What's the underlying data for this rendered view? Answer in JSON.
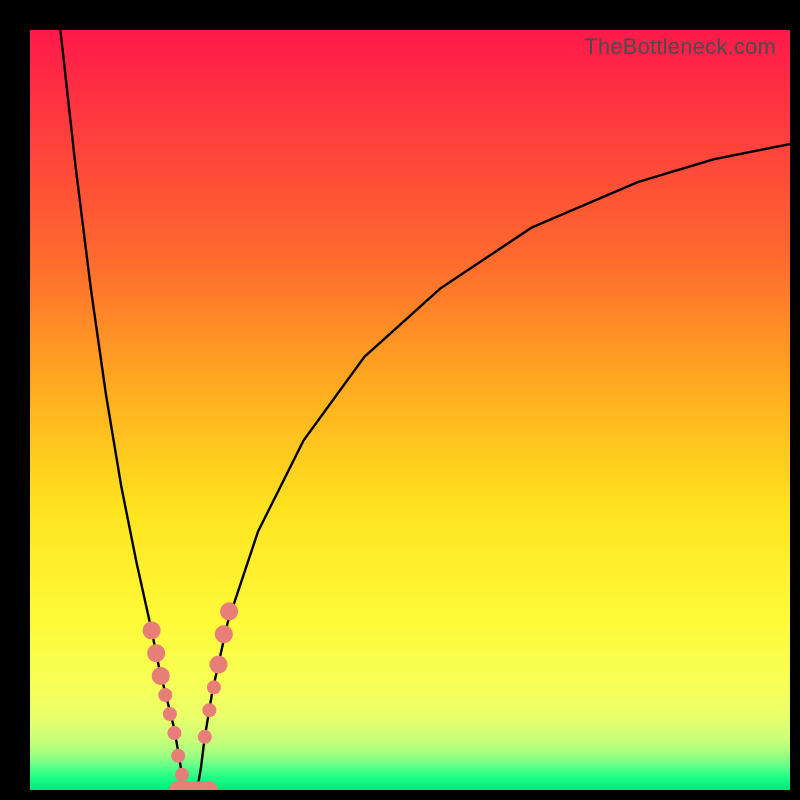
{
  "watermark": "TheBottleneck.com",
  "chart_data": {
    "type": "line",
    "title": "",
    "xlabel": "",
    "ylabel": "",
    "xlim": [
      0,
      100
    ],
    "ylim": [
      0,
      100
    ],
    "grid": false,
    "description": "Bottleneck-style V-curve over a vertical red→yellow→green gradient. Two black curves descend steeply from the top and meet near the bottom-left forming a V; the right branch then rises logarithmically toward the upper-right. Salmon dots cluster along the lower portions of both branches near the trough.",
    "gradient_stops": [
      {
        "offset": 0.0,
        "color": "#ff1a4b"
      },
      {
        "offset": 0.12,
        "color": "#ff3a3f"
      },
      {
        "offset": 0.3,
        "color": "#ff6a2f"
      },
      {
        "offset": 0.48,
        "color": "#ffb01f"
      },
      {
        "offset": 0.63,
        "color": "#ffe320"
      },
      {
        "offset": 0.78,
        "color": "#fffb3a"
      },
      {
        "offset": 0.86,
        "color": "#f7ff57"
      },
      {
        "offset": 0.905,
        "color": "#eaff6c"
      },
      {
        "offset": 0.935,
        "color": "#c9ff7a"
      },
      {
        "offset": 0.955,
        "color": "#9bff82"
      },
      {
        "offset": 0.97,
        "color": "#5cff88"
      },
      {
        "offset": 0.985,
        "color": "#1aff86"
      },
      {
        "offset": 1.0,
        "color": "#00e67a"
      }
    ],
    "series": [
      {
        "name": "left-branch",
        "x": [
          4,
          6,
          8,
          10,
          12,
          14,
          16,
          17,
          18,
          19,
          19.5,
          20,
          20.5
        ],
        "values": [
          100,
          82,
          66,
          52,
          40,
          30,
          21,
          16,
          12,
          8,
          5,
          2,
          0
        ]
      },
      {
        "name": "right-branch",
        "x": [
          22,
          22.5,
          23,
          24,
          26,
          30,
          36,
          44,
          54,
          66,
          80,
          90,
          100
        ],
        "values": [
          0,
          3,
          7,
          13,
          22,
          34,
          46,
          57,
          66,
          74,
          80,
          83,
          85
        ]
      }
    ],
    "trough_fill_x": [
      20.5,
      22
    ],
    "markers": {
      "color": "#e77f78",
      "radius_primary": 9,
      "radius_secondary": 7,
      "points": [
        {
          "x": 16.0,
          "y": 21.0,
          "r": 9
        },
        {
          "x": 16.6,
          "y": 18.0,
          "r": 9
        },
        {
          "x": 17.2,
          "y": 15.0,
          "r": 9
        },
        {
          "x": 17.8,
          "y": 12.5,
          "r": 7
        },
        {
          "x": 18.4,
          "y": 10.0,
          "r": 7
        },
        {
          "x": 19.0,
          "y": 7.5,
          "r": 7
        },
        {
          "x": 19.5,
          "y": 4.5,
          "r": 7
        },
        {
          "x": 20.0,
          "y": 2.0,
          "r": 7
        },
        {
          "x": 19.5,
          "y": 0.0,
          "r": 9
        },
        {
          "x": 20.5,
          "y": 0.0,
          "r": 9
        },
        {
          "x": 21.5,
          "y": 0.0,
          "r": 9
        },
        {
          "x": 22.5,
          "y": 0.0,
          "r": 9
        },
        {
          "x": 23.5,
          "y": 0.0,
          "r": 9
        },
        {
          "x": 23.0,
          "y": 7.0,
          "r": 7
        },
        {
          "x": 23.6,
          "y": 10.5,
          "r": 7
        },
        {
          "x": 24.2,
          "y": 13.5,
          "r": 7
        },
        {
          "x": 24.8,
          "y": 16.5,
          "r": 9
        },
        {
          "x": 25.5,
          "y": 20.5,
          "r": 9
        },
        {
          "x": 26.2,
          "y": 23.5,
          "r": 9
        }
      ]
    }
  }
}
